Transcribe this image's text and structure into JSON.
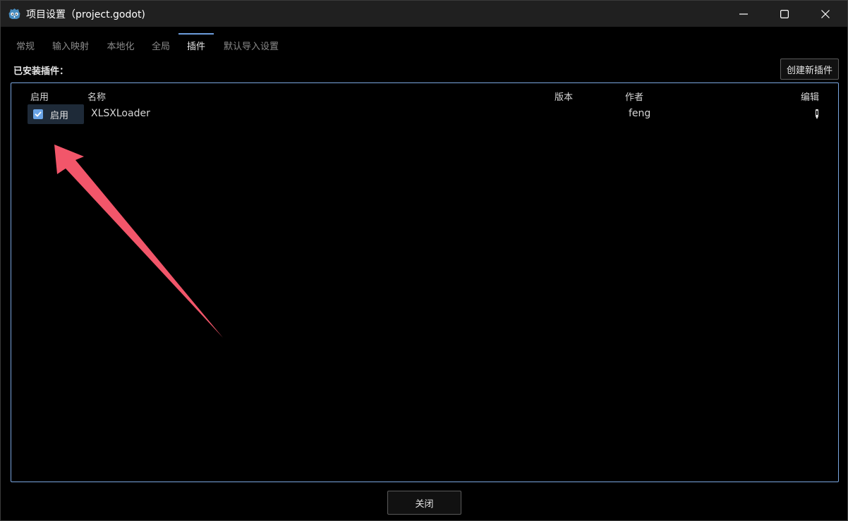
{
  "window": {
    "title": "项目设置（project.godot)",
    "app_icon": "godot-icon"
  },
  "tabs": [
    {
      "label": "常规",
      "active": false
    },
    {
      "label": "输入映射",
      "active": false
    },
    {
      "label": "本地化",
      "active": false
    },
    {
      "label": "全局",
      "active": false
    },
    {
      "label": "插件",
      "active": true
    },
    {
      "label": "默认导入设置",
      "active": false
    }
  ],
  "plugins": {
    "section_label": "已安装插件：",
    "create_button": "创建新插件",
    "columns": {
      "enable": "启用",
      "name": "名称",
      "version": "版本",
      "author": "作者",
      "edit": "编辑"
    },
    "rows": [
      {
        "enabled": true,
        "enable_label": "启用",
        "name": "XLSXLoader",
        "version": "",
        "author": "feng",
        "edit_icon": "pencil-icon"
      }
    ]
  },
  "footer": {
    "close_button": "关闭"
  },
  "colors": {
    "accent": "#6d9ddc",
    "panel_border": "#7aa6e0",
    "annotation_arrow": "#f2566a",
    "titlebar": "#202020"
  }
}
